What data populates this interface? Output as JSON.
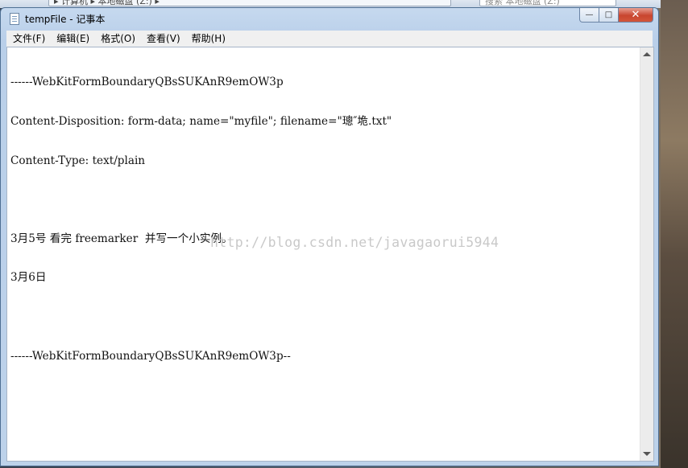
{
  "background": {
    "breadcrumb": "▸ 计算机 ▸ 本地磁盘 (Z:) ▸",
    "search_placeholder": "搜索 本地磁盘 (Z:)"
  },
  "window": {
    "title": "tempFile - 记事本",
    "minimize_glyph": "—",
    "maximize_glyph": "□",
    "close_glyph": "✕"
  },
  "menu": [
    {
      "label": "文件(F)"
    },
    {
      "label": "编辑(E)"
    },
    {
      "label": "格式(O)"
    },
    {
      "label": "查看(V)"
    },
    {
      "label": "帮助(H)"
    }
  ],
  "document": {
    "lines": [
      "------WebKitFormBoundaryQBsSUKAnR9emOW3p",
      "Content-Disposition: form-data; name=\"myfile\"; filename=\"璁″垝.txt\"",
      "Content-Type: text/plain",
      "",
      "3月5号 看完 freemarker  并写一个小实例。",
      "3月6日",
      "",
      "------WebKitFormBoundaryQBsSUKAnR9emOW3p--"
    ],
    "watermark": "http://blog.csdn.net/javagaorui5944"
  },
  "colors": {
    "title_bar": "#c6d9ef",
    "close_button": "#c8452f",
    "editor_bg": "#ffffff",
    "watermark": "#c9c9c9"
  }
}
